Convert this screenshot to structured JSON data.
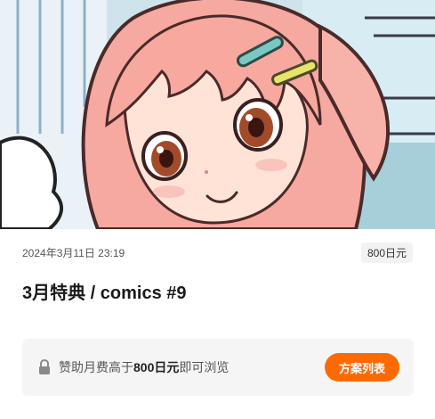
{
  "post": {
    "date": "2024年3月11日 23:19",
    "price_badge": "800日元",
    "title": "3月特典 / comics #9"
  },
  "paywall": {
    "text_before": "赞助月费高于",
    "amount": "800日元",
    "text_after": "即可浏览",
    "button_label": "方案列表"
  },
  "colors": {
    "accent": "#ff6a00",
    "paywall_bg": "#f5f5f5",
    "badge_bg": "#f2f2f2"
  },
  "icons": {
    "lock": "lock-icon"
  }
}
